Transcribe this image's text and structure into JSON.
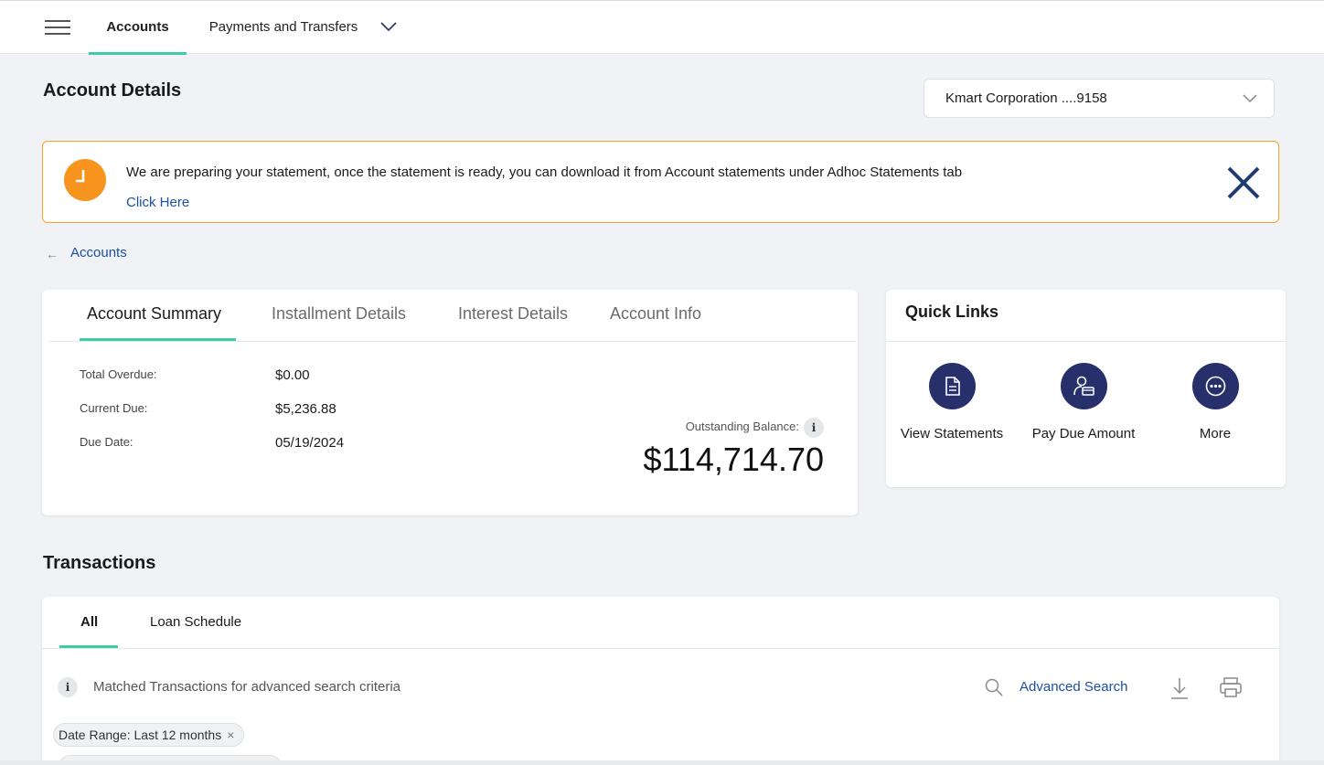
{
  "nav": {
    "tabs": [
      {
        "label": "Accounts",
        "active": true
      },
      {
        "label": "Payments and Transfers",
        "active": false
      }
    ]
  },
  "page": {
    "title": "Account Details",
    "account_selector": "Kmart Corporation ....9158"
  },
  "banner": {
    "message": "We are preparing your statement, once the statement is ready, you can download it from Account statements under Adhoc Statements tab",
    "link": "Click Here"
  },
  "breadcrumb": {
    "arrow": "←",
    "label": "Accounts"
  },
  "summary": {
    "tabs": [
      "Account Summary",
      "Installment Details",
      "Interest Details",
      "Account Info"
    ],
    "fields": [
      {
        "label": "Total Overdue:",
        "value": "$0.00"
      },
      {
        "label": "Current Due:",
        "value": "$5,236.88"
      },
      {
        "label": "Due Date:",
        "value": "05/19/2024"
      }
    ],
    "outstanding_label": "Outstanding Balance:",
    "outstanding_value": "$114,714.70",
    "info_glyph": "i"
  },
  "quick_links": {
    "title": "Quick Links",
    "items": [
      {
        "label": "View Statements",
        "icon": "document-icon"
      },
      {
        "label": "Pay Due Amount",
        "icon": "pay-user-icon"
      },
      {
        "label": "More",
        "icon": "more-dots-icon"
      }
    ]
  },
  "transactions": {
    "title": "Transactions",
    "tabs": [
      "All",
      "Loan Schedule"
    ],
    "info_glyph": "i",
    "matched_text": "Matched Transactions for advanced search criteria",
    "advanced_search": "Advanced Search",
    "chip": {
      "label": "Date Range: Last 12 months",
      "remove": "×"
    }
  },
  "colors": {
    "accent_teal": "#3ecbaa",
    "link_blue": "#1c4fa0",
    "warning_orange": "#f7941d",
    "icon_navy": "#27306b"
  }
}
